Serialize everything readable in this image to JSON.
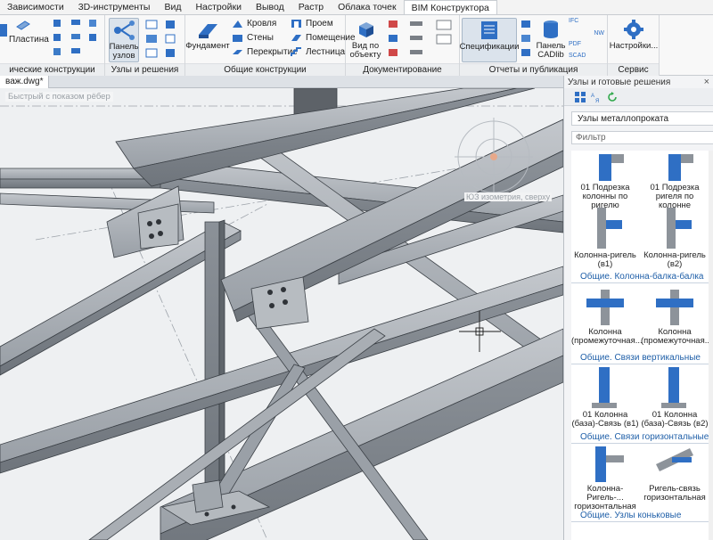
{
  "ribbon": {
    "tabs": [
      "Зависимости",
      "3D-инструменты",
      "Вид",
      "Настройки",
      "Вывод",
      "Растр",
      "Облака точек",
      "BIM Конструктора"
    ],
    "active_tab": 7,
    "groups": {
      "metal": {
        "label": "ические конструкции",
        "plate_label": "Пластина"
      },
      "nodes": {
        "label": "Узлы и решения",
        "nodes_panel_label": "Панель узлов"
      },
      "general": {
        "label": "Общие конструкции",
        "foundation_label": "Фундамент",
        "roof_label": "Кровля",
        "walls_label": "Стены",
        "slabs_label": "Перекрытие",
        "opening_label": "Проем",
        "room_label": "Помещение",
        "stair_label": "Лестница"
      },
      "docs": {
        "label": "Документирование",
        "object_view_label": "Вид по объекту"
      },
      "reports": {
        "label": "Отчеты и публикация",
        "specs_label": "Спецификации",
        "cadlib_label": "Панель CADlib",
        "ifc_tag": "IFC",
        "pdf_tag": "PDF",
        "scad_tag": "SCAD",
        "nw_tag": "NW"
      },
      "service": {
        "label": "Сервис",
        "settings_label": "Настройки..."
      }
    }
  },
  "document": {
    "tab_label": "важ.dwg*",
    "visual_style": "Быстрый с показом рёбер",
    "view_name": "ЮЗ изометрия, сверху"
  },
  "panel": {
    "title": "Узлы и готовые решения",
    "close_glyph": "×",
    "section": "Узлы металлопроката",
    "filter_placeholder": "Фильтр",
    "items_top": [
      {
        "label": "01 Подрезка колонны по ригелю"
      },
      {
        "label": "01 Подрезка ригеля по колонне"
      },
      {
        "label": "Колонна-ригель (в1)"
      },
      {
        "label": "Колонна-ригель (в2)"
      }
    ],
    "categories": [
      {
        "title": "Общие. Колонна-балка-балка",
        "items": [
          {
            "label": "Колонна (промежуточная..."
          },
          {
            "label": "Колонна (промежуточная..."
          }
        ]
      },
      {
        "title": "Общие. Связи вертикальные",
        "items": [
          {
            "label": "01 Колонна (база)-Связь (в1)"
          },
          {
            "label": "01 Колонна (база)-Связь (в2)"
          }
        ]
      },
      {
        "title": "Общие. Связи горизонтальные",
        "items": [
          {
            "label": "Колонна-Ригель-... горизонтальная"
          },
          {
            "label": "Ригель-связь горизонтальная"
          }
        ]
      },
      {
        "title": "Общие. Узлы коньковые",
        "items": []
      }
    ]
  },
  "colors": {
    "accent_blue": "#2f6fc4",
    "category_text": "#1f5fa8",
    "steel": "#8d939a"
  }
}
